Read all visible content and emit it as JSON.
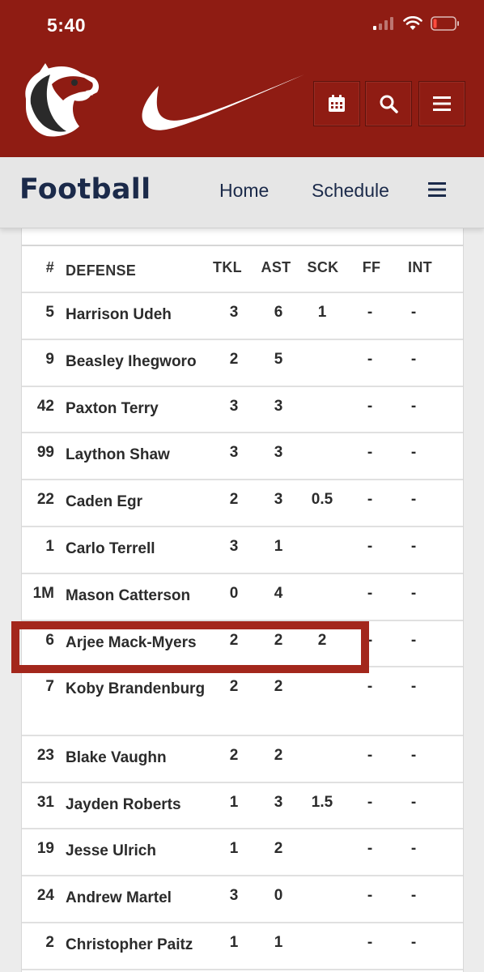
{
  "status_bar": {
    "time": "5:40"
  },
  "header": {
    "sport_title": "Football",
    "nav": {
      "home": "Home",
      "schedule": "Schedule"
    }
  },
  "colors": {
    "brand_red": "#8f1c13",
    "navy": "#1b2a4a",
    "highlight": "#a3271c"
  },
  "table": {
    "columns": [
      "#",
      "DEFENSE",
      "TKL",
      "AST",
      "SCK",
      "FF",
      "INT"
    ],
    "rows": [
      {
        "num": "5",
        "name": "Harrison Udeh",
        "tkl": "3",
        "ast": "6",
        "sck": "1",
        "ff": "-",
        "int": "-"
      },
      {
        "num": "9",
        "name": "Beasley Ihegworo",
        "tkl": "2",
        "ast": "5",
        "sck": "",
        "ff": "-",
        "int": "-"
      },
      {
        "num": "42",
        "name": "Paxton Terry",
        "tkl": "3",
        "ast": "3",
        "sck": "",
        "ff": "-",
        "int": "-"
      },
      {
        "num": "99",
        "name": "Laython Shaw",
        "tkl": "3",
        "ast": "3",
        "sck": "",
        "ff": "-",
        "int": "-"
      },
      {
        "num": "22",
        "name": "Caden Egr",
        "tkl": "2",
        "ast": "3",
        "sck": "0.5",
        "ff": "-",
        "int": "-"
      },
      {
        "num": "1",
        "name": "Carlo Terrell",
        "tkl": "3",
        "ast": "1",
        "sck": "",
        "ff": "-",
        "int": "-"
      },
      {
        "num": "1M",
        "name": "Mason Catterson",
        "tkl": "0",
        "ast": "4",
        "sck": "",
        "ff": "-",
        "int": "-"
      },
      {
        "num": "6",
        "name": "Arjee Mack-Myers",
        "tkl": "2",
        "ast": "2",
        "sck": "2",
        "ff": "-",
        "int": "-"
      },
      {
        "num": "7",
        "name": "Koby Brandenburg",
        "tkl": "2",
        "ast": "2",
        "sck": "",
        "ff": "-",
        "int": "-"
      },
      {
        "num": "23",
        "name": "Blake Vaughn",
        "tkl": "2",
        "ast": "2",
        "sck": "",
        "ff": "-",
        "int": "-"
      },
      {
        "num": "31",
        "name": "Jayden Roberts",
        "tkl": "1",
        "ast": "3",
        "sck": "1.5",
        "ff": "-",
        "int": "-"
      },
      {
        "num": "19",
        "name": "Jesse Ulrich",
        "tkl": "1",
        "ast": "2",
        "sck": "",
        "ff": "-",
        "int": "-"
      },
      {
        "num": "24",
        "name": "Andrew Martel",
        "tkl": "3",
        "ast": "0",
        "sck": "",
        "ff": "-",
        "int": "-"
      },
      {
        "num": "2",
        "name": "Christopher Paitz",
        "tkl": "1",
        "ast": "1",
        "sck": "",
        "ff": "-",
        "int": "-"
      }
    ]
  }
}
